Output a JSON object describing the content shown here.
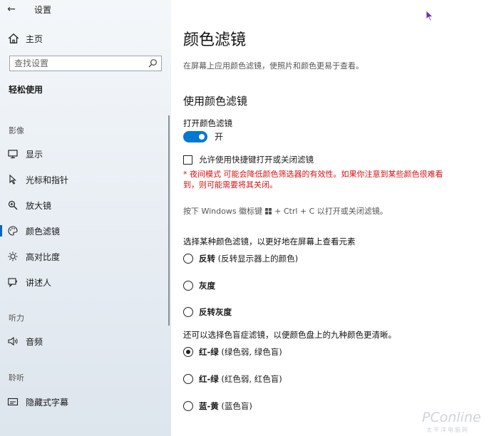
{
  "window": {
    "back_glyph": "←",
    "title": "设置"
  },
  "sidebar": {
    "home_label": "主页",
    "search_placeholder": "查找设置",
    "section_title": "轻松使用",
    "groups": {
      "vision": "影像",
      "hearing": "听力",
      "interaction": "聆听"
    },
    "items": [
      {
        "label": "显示",
        "icon": "monitor-icon"
      },
      {
        "label": "光标和指针",
        "icon": "pointer-icon"
      },
      {
        "label": "放大镜",
        "icon": "magnifier-icon"
      },
      {
        "label": "颜色滤镜",
        "icon": "palette-icon",
        "active": true
      },
      {
        "label": "高对比度",
        "icon": "sun-icon"
      },
      {
        "label": "讲述人",
        "icon": "narrator-icon"
      },
      {
        "label": "音频",
        "icon": "speaker-icon"
      },
      {
        "label": "隐藏式字幕",
        "icon": "caption-icon"
      }
    ]
  },
  "main": {
    "title": "颜色滤镜",
    "description": "在屏幕上应用颜色滤镜，使照片和颜色更易于查看。",
    "subtitle": "使用颜色滤镜",
    "toggle_label": "打开颜色滤镜",
    "toggle_state": "开",
    "shortcut_checkbox": "允许使用快捷键打开或关闭滤镜",
    "warning": "* 夜间模式 可能会降低颜色筛选器的有效性。如果你注意到某些颜色很难看到，则可能需要将其关闭。",
    "hint_prefix": "按下 Windows 徽标键",
    "hint_suffix": "+ Ctrl + C 以打开或关闭滤镜。",
    "choose_label": "选择某种颜色滤镜，以更好地在屏幕上查看元素",
    "filters": [
      {
        "name": "反转",
        "detail": " (反转显示器上的颜色)",
        "checked": false
      },
      {
        "name": "灰度",
        "detail": "",
        "checked": false
      },
      {
        "name": "反转灰度",
        "detail": "",
        "checked": false
      }
    ],
    "colorblind_label": "还可以选择色盲症滤镜，以便颜色盘上的九种颜色更清晰。",
    "colorblind_filters": [
      {
        "name": "红-绿",
        "detail": " (绿色弱, 绿色盲)",
        "checked": true
      },
      {
        "name": "红-绿",
        "detail": " (红色弱, 红色盲)",
        "checked": false
      },
      {
        "name": "蓝-黄",
        "detail": " (蓝色盲)",
        "checked": false
      }
    ]
  },
  "watermark": {
    "brand": "PConline",
    "sub": "太平洋电脑网"
  },
  "colors": {
    "accent": "#0078d4",
    "warning": "#d21414"
  }
}
